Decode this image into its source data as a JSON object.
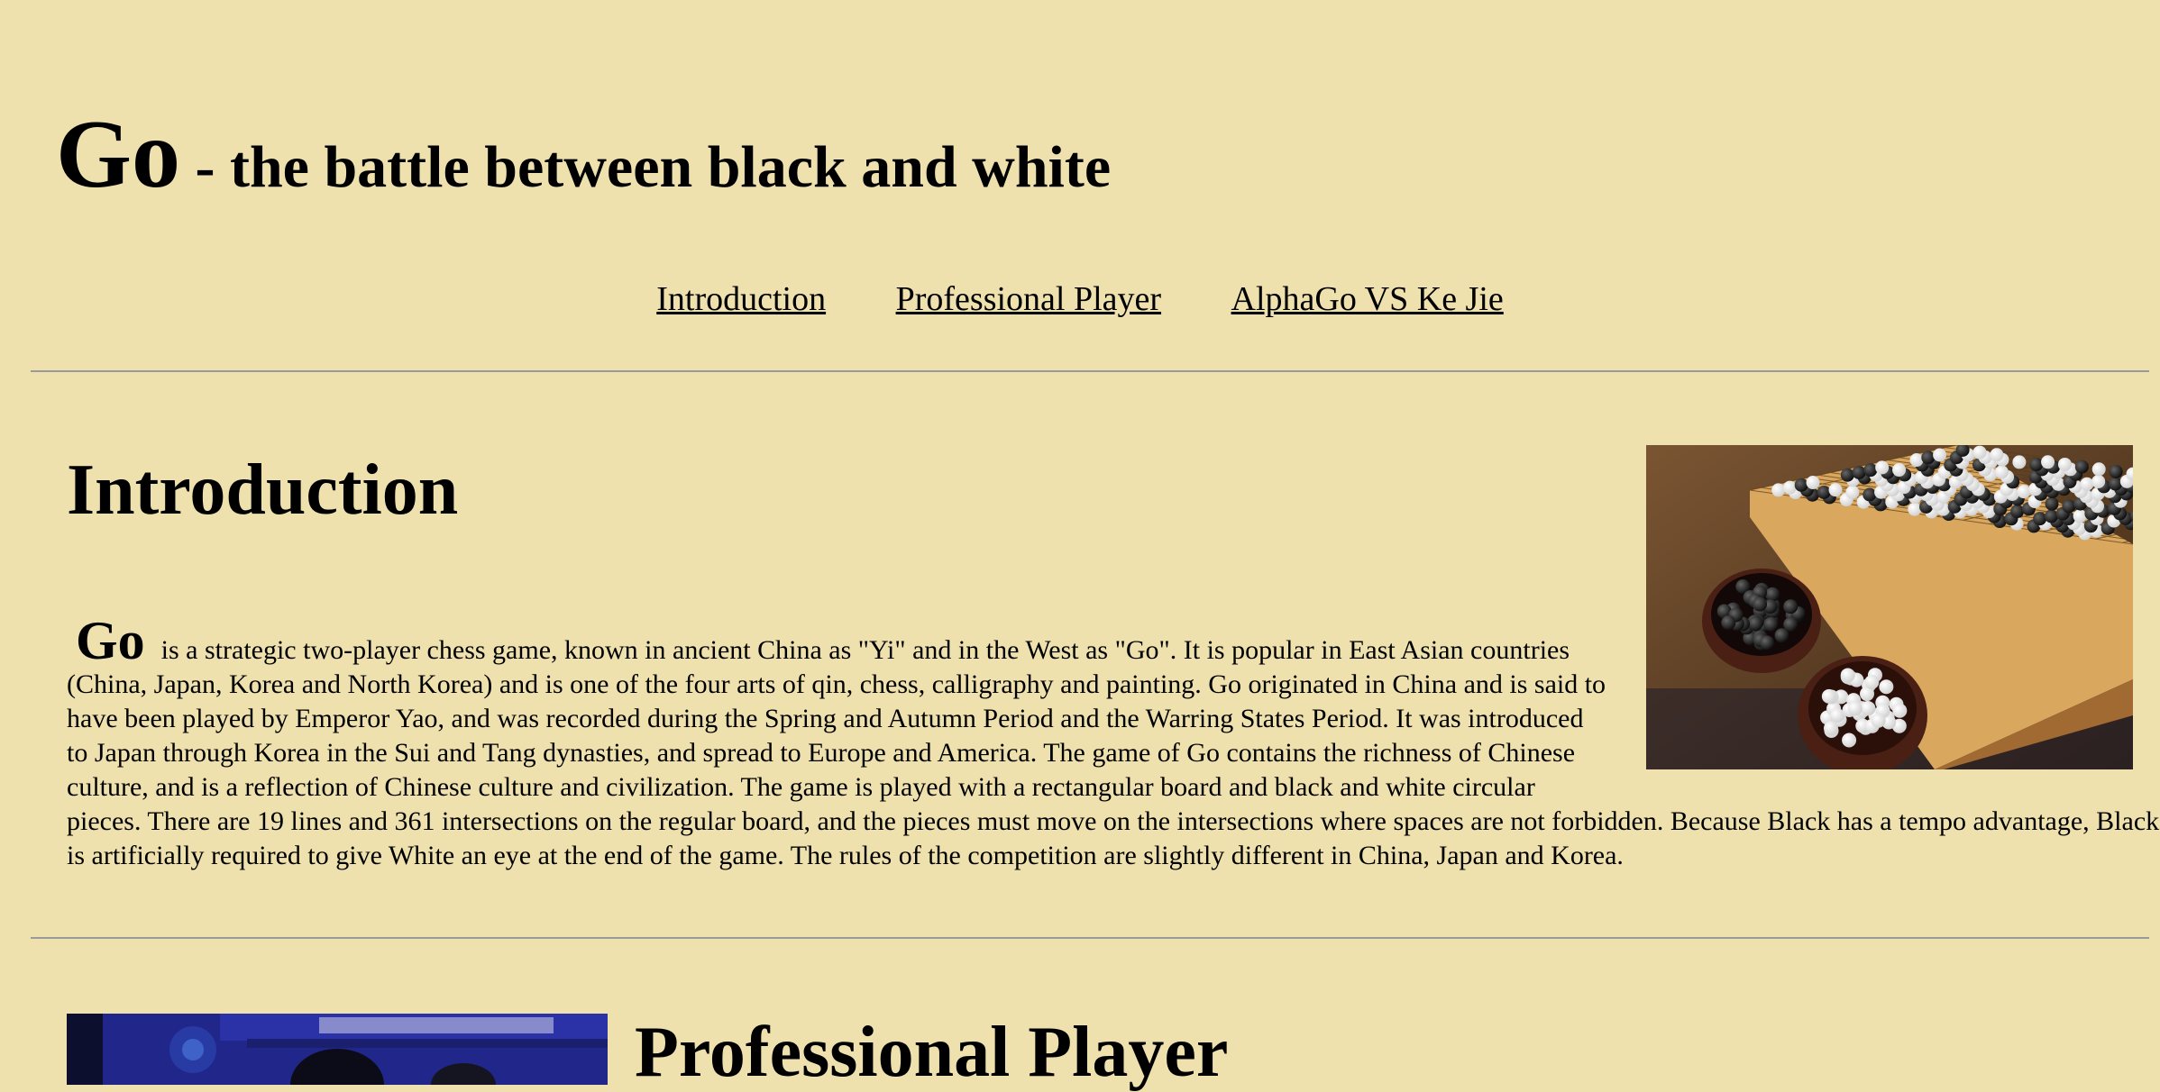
{
  "header": {
    "title_big": "Go",
    "title_rest": " - the battle between black and white"
  },
  "nav": {
    "items": [
      {
        "label": "Introduction"
      },
      {
        "label": "Professional Player"
      },
      {
        "label": "AlphaGo VS Ke Jie"
      }
    ]
  },
  "intro": {
    "heading": "Introduction",
    "dropword": "Go",
    "paragraph": "is a strategic two-player chess game, known in ancient China as \"Yi\" and in the West as \"Go\". It is popular in East Asian countries (China, Japan, Korea and North Korea) and is one of the four arts of qin, chess, calligraphy and painting. Go originated in China and is said to have been played by Emperor Yao, and was recorded during the Spring and Autumn Period and the Warring States Period. It was introduced to Japan through Korea in the Sui and Tang dynasties, and spread to Europe and America. The game of Go contains the richness of Chinese culture, and is a reflection of Chinese culture and civilization. The game is played with a rectangular board and black and white circular pieces. There are 19 lines and 361 intersections on the regular board, and the pieces must move on the intersections where spaces are not forbidden. Because Black has a tempo advantage, Black is artificially required to give White an eye at the end of the game. The rules of the competition are slightly different in China, Japan and Korea."
  },
  "player": {
    "heading": "Professional Player"
  },
  "colors": {
    "background": "#efe1ae",
    "rule": "#9a9a9a"
  }
}
